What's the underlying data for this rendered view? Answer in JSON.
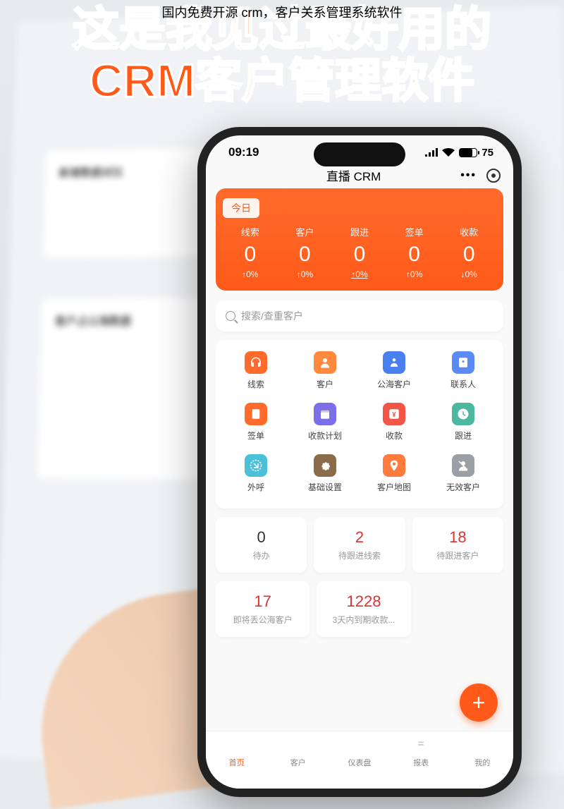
{
  "overlay": {
    "caption": "国内免费开源 crm，客户关系管理系统软件",
    "title_line1": "这是我见过最好用的",
    "title_line2": "CRM客户管理软件"
  },
  "status": {
    "time": "09:19",
    "battery_pct": "75"
  },
  "appbar": {
    "title": "直播 CRM"
  },
  "today": {
    "tag": "今日",
    "metrics": [
      {
        "label": "线索",
        "value": "0",
        "trend": "↑0%"
      },
      {
        "label": "客户",
        "value": "0",
        "trend": "↑0%"
      },
      {
        "label": "跟进",
        "value": "0",
        "trend": "↑0%"
      },
      {
        "label": "签单",
        "value": "0",
        "trend": "↑0%"
      },
      {
        "label": "收款",
        "value": "0",
        "trend": "↓0%"
      }
    ]
  },
  "search": {
    "placeholder": "搜索/查重客户"
  },
  "functions": {
    "row1": [
      {
        "label": "线索",
        "icon": "headset-icon",
        "color": "ico-orange"
      },
      {
        "label": "客户",
        "icon": "person-icon",
        "color": "ico-orange2"
      },
      {
        "label": "公海客户",
        "icon": "person-cloud-icon",
        "color": "ico-blue"
      },
      {
        "label": "联系人",
        "icon": "contact-icon",
        "color": "ico-blue2"
      }
    ],
    "row2": [
      {
        "label": "签单",
        "icon": "document-check-icon",
        "color": "ico-orange"
      },
      {
        "label": "收款计划",
        "icon": "calendar-icon",
        "color": "ico-zi"
      },
      {
        "label": "收款",
        "icon": "yuan-icon",
        "color": "ico-red"
      },
      {
        "label": "跟进",
        "icon": "followup-icon",
        "color": "ico-teal"
      }
    ],
    "row3": [
      {
        "label": "外呼",
        "icon": "phone-out-icon",
        "color": "ico-cyan"
      },
      {
        "label": "基础设置",
        "icon": "gear-icon",
        "color": "ico-dk"
      },
      {
        "label": "客户地图",
        "icon": "location-icon",
        "color": "ico-loc"
      },
      {
        "label": "无效客户",
        "icon": "invalid-icon",
        "color": "ico-gray"
      }
    ]
  },
  "stats": {
    "row1": [
      {
        "value": "0",
        "label": "待办",
        "color": "c-black"
      },
      {
        "value": "2",
        "label": "待跟进线索",
        "color": "c-red"
      },
      {
        "value": "18",
        "label": "待跟进客户",
        "color": "c-red"
      }
    ],
    "row2": [
      {
        "value": "17",
        "label": "即将丢公海客户",
        "color": "c-red"
      },
      {
        "value": "1228",
        "label": "3天内到期收款...",
        "color": "c-red"
      }
    ]
  },
  "tabs": [
    {
      "label": "首页",
      "active": true,
      "icon": "home-icon"
    },
    {
      "label": "客户",
      "active": false,
      "icon": "grid-icon"
    },
    {
      "label": "仪表盘",
      "active": false,
      "icon": "dashboard-icon"
    },
    {
      "label": "报表",
      "active": false,
      "icon": "report-icon"
    },
    {
      "label": "我的",
      "active": false,
      "icon": "person-icon"
    }
  ]
}
